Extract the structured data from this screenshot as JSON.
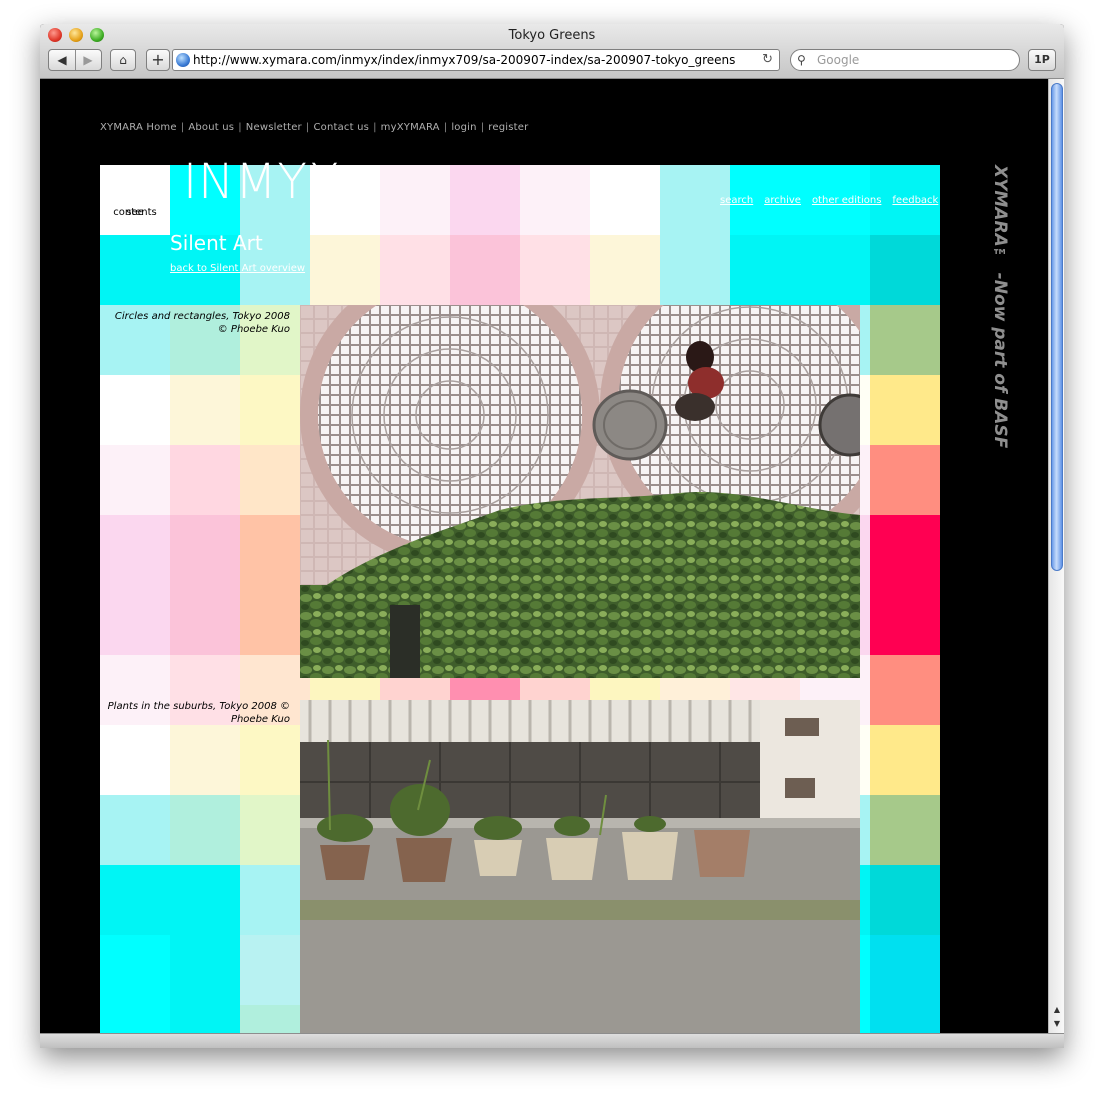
{
  "window": {
    "title": "Tokyo Greens",
    "url": "http://www.xymara.com/inmyx/index/inmyx709/sa-200907-index/sa-200907-tokyo_greens",
    "search_placeholder": "Google",
    "password_button": "1P"
  },
  "site_nav": {
    "items": [
      "XYMARA Home",
      "About us",
      "Newsletter",
      "Contact us",
      "myXYMARA",
      "login",
      "register"
    ]
  },
  "sidebar": {
    "see_contents_line1": "see",
    "see_contents_line2": "contents"
  },
  "brand": {
    "logo_text": "INMYX",
    "vertical_text": "XYMARA™ -Now part of BASF"
  },
  "top_links": [
    "search",
    "archive",
    "other editions",
    "feedback"
  ],
  "section": {
    "title": "Silent Art",
    "back_link": "back to Silent Art overview"
  },
  "photos": [
    {
      "caption": "Circles and rectangles, Tokyo 2008 © Phoebe Kuo"
    },
    {
      "caption": "Plants in the suburbs, Tokyo 2008 © Phoebe Kuo"
    }
  ],
  "colors": {
    "page_background": "#000000",
    "cyan": "#00f5f5",
    "pink": "#fbd7ef",
    "peach": "#ffc3a6",
    "magenta": "#ff0052",
    "yellow": "#fdf6c0"
  }
}
